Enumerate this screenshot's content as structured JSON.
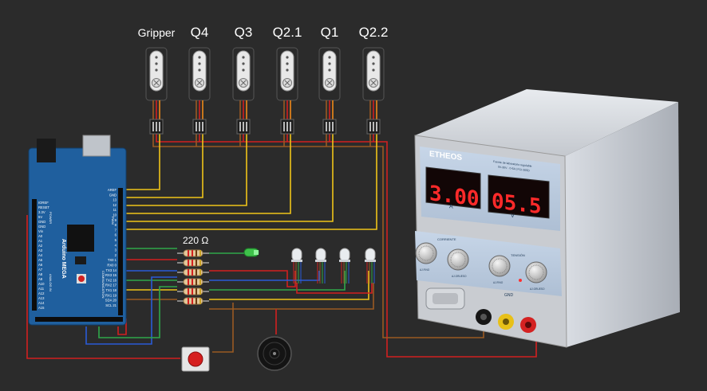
{
  "servos": [
    {
      "label": "Gripper"
    },
    {
      "label": "Q4"
    },
    {
      "label": "Q3"
    },
    {
      "label": "Q2.1"
    },
    {
      "label": "Q1"
    },
    {
      "label": "Q2.2"
    }
  ],
  "resistor_label": "220 Ω",
  "arduino": {
    "name": "Arduino MEGA",
    "pins_left": [
      "IOREF",
      "RESET",
      "3.3V",
      "5V",
      "GND",
      "GND",
      "Vin",
      "A0",
      "A1",
      "A2",
      "A3",
      "A4",
      "A5",
      "A6",
      "A7",
      "A8",
      "A9",
      "A10",
      "A11",
      "A12",
      "A13",
      "A14",
      "A15"
    ],
    "pins_right": [
      "AREF",
      "GND",
      "13",
      "12",
      "11",
      "10",
      "9",
      "8",
      "7",
      "6",
      "5",
      "4",
      "3",
      "2",
      "TX0 1",
      "RX0 0",
      "TX3 14",
      "RX3 15",
      "TX2 16",
      "RX2 17",
      "TX1 18",
      "RX1 19",
      "SDA 20",
      "SCL 21"
    ],
    "pwm_label": "PWM",
    "power_label": "POWER",
    "analog_label": "ANALOG IN",
    "comm_label": "COMMUNICATION"
  },
  "power_supply": {
    "brand": "ETHEOS",
    "subtitle": "Fuente de laboratorio regulable",
    "model": "0V-30V · 0-5A | FCI-305D",
    "current_display": "3.00",
    "current_unit": "A",
    "voltage_display": "05.5",
    "voltage_unit": "V",
    "current_group": "CORRIENTE",
    "voltage_group": "TENSIÓN",
    "knob_labels": [
      "AJ.FINO",
      "AJ.GRUESO",
      "AJ.FINO",
      "AJ.GRUESO"
    ],
    "gnd_label": "GND"
  },
  "colors": {
    "background": "#2b2b2b",
    "wire_red": "#d22020",
    "wire_yellow": "#f0c419",
    "wire_green": "#2fa84a",
    "wire_blue": "#2a5bd7",
    "wire_brown": "#9a5a22",
    "board_blue": "#1f5f9e",
    "display_red": "#ff2a2a"
  }
}
